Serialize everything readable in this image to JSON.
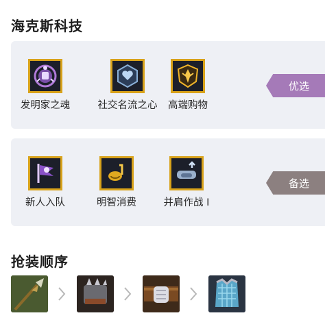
{
  "tech_title": "海克斯科技",
  "preferred": {
    "tag": "优选",
    "tag_color": "#a57ab8",
    "augments": [
      {
        "name": "发明家之魂",
        "icon": "inventor-soul-icon"
      },
      {
        "name": "社交名流之心",
        "icon": "socialite-heart-icon"
      },
      {
        "name": "高端购物",
        "icon": "high-end-shopping-icon"
      }
    ]
  },
  "alternate": {
    "tag": "备选",
    "tag_color": "#8c8080",
    "augments": [
      {
        "name": "新人入队",
        "icon": "new-recruit-icon"
      },
      {
        "name": "明智消费",
        "icon": "wise-spending-icon"
      },
      {
        "name": "并肩作战 I",
        "icon": "shoulder-to-shoulder-icon"
      }
    ]
  },
  "build_title": "抢装顺序",
  "build_order": [
    {
      "icon": "spear-item-icon"
    },
    {
      "icon": "spiked-gauntlet-item-icon"
    },
    {
      "icon": "fist-belt-item-icon"
    },
    {
      "icon": "crystal-armor-item-icon"
    }
  ],
  "colors": {
    "accent_border": "#d8a21a",
    "panel_bg": "#eef0f5"
  }
}
